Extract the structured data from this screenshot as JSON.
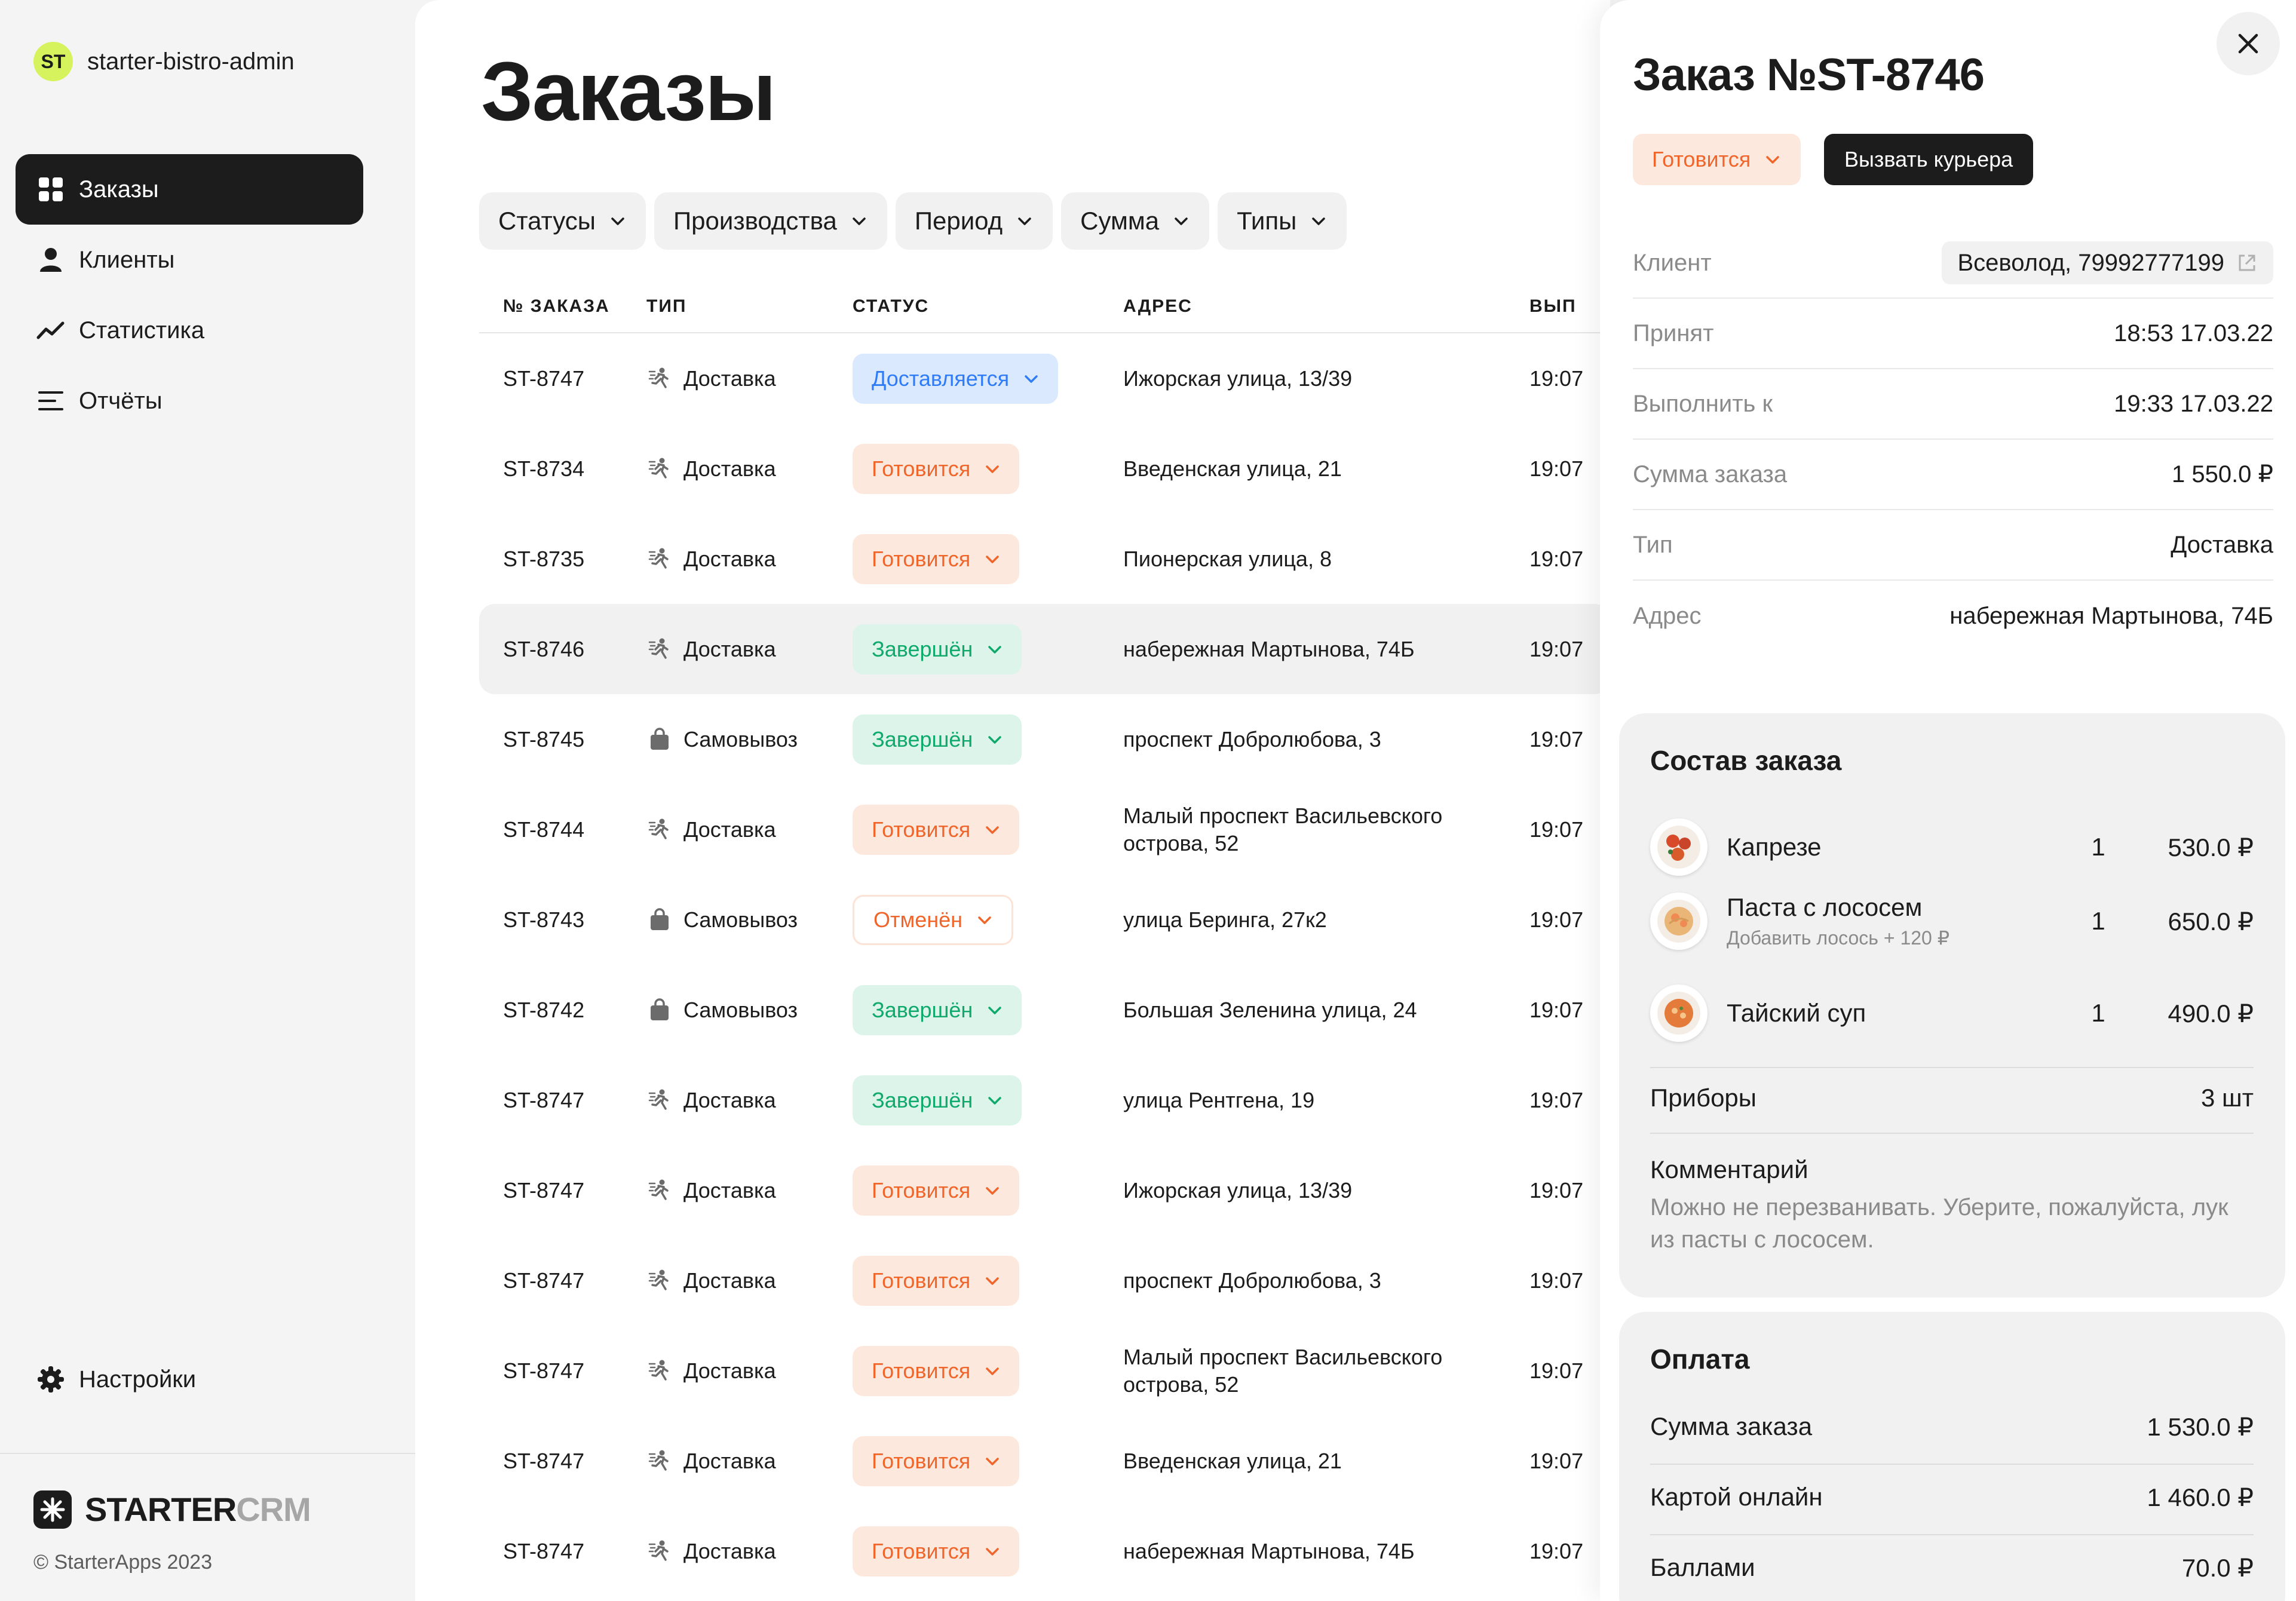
{
  "app": {
    "logo_text": "ST",
    "name": "starter-bistro-admin"
  },
  "nav": [
    {
      "label": "Заказы",
      "icon": "grid-icon",
      "active": true
    },
    {
      "label": "Клиенты",
      "icon": "user-icon",
      "active": false
    },
    {
      "label": "Статистика",
      "icon": "chart-line-icon",
      "active": false
    },
    {
      "label": "Отчёты",
      "icon": "list-icon",
      "active": false
    }
  ],
  "settings_label": "Настройки",
  "footer": {
    "brand_dark": "STARTER",
    "brand_light": "CRM",
    "copyright": "© StarterApps 2023"
  },
  "page_title": "Заказы",
  "filters": [
    "Статусы",
    "Производства",
    "Период",
    "Сумма",
    "Типы"
  ],
  "table": {
    "columns": [
      "№ ЗАКАЗА",
      "ТИП",
      "СТАТУС",
      "АДРЕС",
      "ВЫП"
    ],
    "rows": [
      {
        "num": "ST-8747",
        "type": "Доставка",
        "type_icon": "courier-icon",
        "status": "Доставляется",
        "status_kind": "delivery",
        "addr": "Ижорская улица, 13/39",
        "time": "19:07"
      },
      {
        "num": "ST-8734",
        "type": "Доставка",
        "type_icon": "courier-icon",
        "status": "Готовится",
        "status_kind": "cooking",
        "addr": "Введенская улица, 21",
        "time": "19:07"
      },
      {
        "num": "ST-8735",
        "type": "Доставка",
        "type_icon": "courier-icon",
        "status": "Готовится",
        "status_kind": "cooking",
        "addr": "Пионерская улица, 8",
        "time": "19:07"
      },
      {
        "num": "ST-8746",
        "type": "Доставка",
        "type_icon": "courier-icon",
        "status": "Завершён",
        "status_kind": "done",
        "addr": "набережная Мартынова, 74Б",
        "time": "19:07",
        "selected": true
      },
      {
        "num": "ST-8745",
        "type": "Самовывоз",
        "type_icon": "bag-icon",
        "status": "Завершён",
        "status_kind": "done",
        "addr": "проспект Добролюбова, 3",
        "time": "19:07"
      },
      {
        "num": "ST-8744",
        "type": "Доставка",
        "type_icon": "courier-icon",
        "status": "Готовится",
        "status_kind": "cooking",
        "addr": "Малый проспект Васильевского острова, 52",
        "time": "19:07"
      },
      {
        "num": "ST-8743",
        "type": "Самовывоз",
        "type_icon": "bag-icon",
        "status": "Отменён",
        "status_kind": "cancel",
        "addr": "улица Беринга, 27к2",
        "time": "19:07"
      },
      {
        "num": "ST-8742",
        "type": "Самовывоз",
        "type_icon": "bag-icon",
        "status": "Завершён",
        "status_kind": "done",
        "addr": "Большая Зеленина улица, 24",
        "time": "19:07"
      },
      {
        "num": "ST-8747",
        "type": "Доставка",
        "type_icon": "courier-icon",
        "status": "Завершён",
        "status_kind": "done",
        "addr": "улица Рентгена, 19",
        "time": "19:07"
      },
      {
        "num": "ST-8747",
        "type": "Доставка",
        "type_icon": "courier-icon",
        "status": "Готовится",
        "status_kind": "cooking",
        "addr": "Ижорская улица, 13/39",
        "time": "19:07"
      },
      {
        "num": "ST-8747",
        "type": "Доставка",
        "type_icon": "courier-icon",
        "status": "Готовится",
        "status_kind": "cooking",
        "addr": "проспект Добролюбова, 3",
        "time": "19:07"
      },
      {
        "num": "ST-8747",
        "type": "Доставка",
        "type_icon": "courier-icon",
        "status": "Готовится",
        "status_kind": "cooking",
        "addr": "Малый проспект Васильевского острова, 52",
        "time": "19:07"
      },
      {
        "num": "ST-8747",
        "type": "Доставка",
        "type_icon": "courier-icon",
        "status": "Готовится",
        "status_kind": "cooking",
        "addr": "Введенская улица, 21",
        "time": "19:07"
      },
      {
        "num": "ST-8747",
        "type": "Доставка",
        "type_icon": "courier-icon",
        "status": "Готовится",
        "status_kind": "cooking",
        "addr": "набережная Мартынова, 74Б",
        "time": "19:07"
      }
    ]
  },
  "panel": {
    "title": "Заказ №ST-8746",
    "status": "Готовится",
    "courier_button": "Вызвать курьера",
    "info": [
      {
        "label": "Клиент",
        "value": "Всеволод, 79992777199",
        "chip": true
      },
      {
        "label": "Принят",
        "value": "18:53  17.03.22"
      },
      {
        "label": "Выполнить к",
        "value": "19:33  17.03.22"
      },
      {
        "label": "Сумма заказа",
        "value": "1 550.0 ₽"
      },
      {
        "label": "Тип",
        "value": "Доставка"
      },
      {
        "label": "Адрес",
        "value": "набережная Мартынова, 74Б"
      }
    ],
    "composition": {
      "title": "Состав заказа",
      "items": [
        {
          "name": "Капрезе",
          "modifier": "",
          "qty": "1",
          "price": "530.0 ₽",
          "icon": "caprese-dish-icon"
        },
        {
          "name": "Паста с лососем",
          "modifier": "Добавить лосось + 120 ₽",
          "qty": "1",
          "price": "650.0 ₽",
          "icon": "pasta-dish-icon"
        },
        {
          "name": "Тайский суп",
          "modifier": "",
          "qty": "1",
          "price": "490.0 ₽",
          "icon": "soup-dish-icon"
        }
      ],
      "cutlery_label": "Приборы",
      "cutlery_value": "3 шт",
      "comment_label": "Комментарий",
      "comment_text": "Можно не перезванивать. Уберите, пожалуйста, лук из пасты с лососем."
    },
    "payment": {
      "title": "Оплата",
      "rows": [
        {
          "label": "Сумма заказа",
          "value": "1 530.0 ₽"
        },
        {
          "label": "Картой онлайн",
          "value": "1 460.0 ₽"
        },
        {
          "label": "Баллами",
          "value": "70.0 ₽"
        }
      ]
    }
  },
  "colors": {
    "accent_dark": "#1c1c1c",
    "logo_lime": "#d6f35d",
    "status_cooking": "#f0652a",
    "status_done": "#0faa6b",
    "status_delivery": "#2f7cf6"
  }
}
